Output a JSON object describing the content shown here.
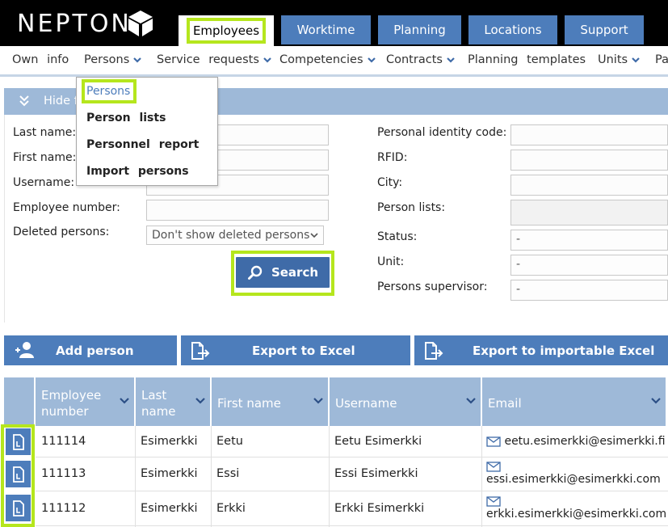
{
  "brand": {
    "logo_text": "NEPTON",
    "logo_icon": "cube-logo-icon"
  },
  "main_tabs": [
    {
      "label": "Employees",
      "active": true
    },
    {
      "label": "Worktime"
    },
    {
      "label": "Planning"
    },
    {
      "label": "Locations"
    },
    {
      "label": "Support"
    }
  ],
  "menu": [
    {
      "label": "Own info"
    },
    {
      "label": "Persons",
      "has_dropdown": true
    },
    {
      "label": "Service requests",
      "has_dropdown": true
    },
    {
      "label": "Competencies",
      "has_dropdown": true
    },
    {
      "label": "Contracts",
      "has_dropdown": true
    },
    {
      "label": "Planning templates"
    },
    {
      "label": "Units",
      "has_dropdown": true
    },
    {
      "label": "Pa"
    }
  ],
  "persons_dropdown": {
    "items": [
      "Persons",
      "Person lists",
      "Personnel report",
      "Import persons"
    ]
  },
  "filter": {
    "toggle_label": "Hide f",
    "left_fields": [
      {
        "label": "Last name:",
        "value": ""
      },
      {
        "label": "First name:",
        "value": ""
      },
      {
        "label": "Username:",
        "value": ""
      },
      {
        "label": "Employee number:",
        "value": ""
      }
    ],
    "deleted_persons": {
      "label": "Deleted persons:",
      "value": "Don't show deleted persons"
    },
    "right_fields": [
      {
        "label": "Personal identity code:",
        "value": ""
      },
      {
        "label": "RFID:",
        "value": ""
      },
      {
        "label": "City:",
        "value": ""
      },
      {
        "label": "Person lists:",
        "value": ""
      },
      {
        "label": "Status:",
        "value": "-"
      },
      {
        "label": "Unit:",
        "value": "-"
      },
      {
        "label": "Persons supervisor:",
        "value": "-"
      }
    ],
    "search_label": "Search"
  },
  "actions": {
    "add_person": "Add person",
    "export_excel": "Export to Excel",
    "export_importable": "Export to importable Excel"
  },
  "table": {
    "columns": [
      {
        "line1": "Employee",
        "line2": "number"
      },
      {
        "line1": "Last",
        "line2": "name"
      },
      {
        "line1": "First name",
        "line2": ""
      },
      {
        "line1": "Username",
        "line2": ""
      },
      {
        "line1": "Email",
        "line2": ""
      }
    ],
    "rows": [
      {
        "employee_number": "111114",
        "last_name": "Esimerkki",
        "first_name": "Eetu",
        "username": "Eetu Esimerkki",
        "email": "eetu.esimerkki@esimerkki.fi"
      },
      {
        "employee_number": "111113",
        "last_name": "Esimerkki",
        "first_name": "Essi",
        "username": "Essi Esimerkki",
        "email": "essi.esimerkki@esimerkki.com"
      },
      {
        "employee_number": "111112",
        "last_name": "Esimerkki",
        "first_name": "Erkki",
        "username": "Erkki Esimerkki",
        "email": "erkki.esimerkki@esimerkki.com"
      }
    ]
  },
  "colors": {
    "tab_blue": "#4d7dbb",
    "header_blue": "#9eb9d8",
    "highlight": "#b5e61d"
  }
}
